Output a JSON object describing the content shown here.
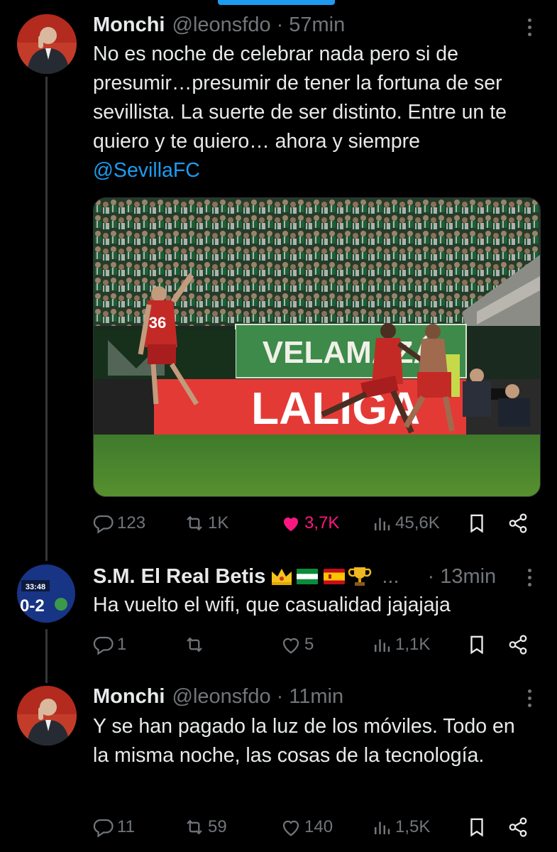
{
  "tweets": [
    {
      "name": "Monchi",
      "handle": "@leonsfdo",
      "sep": "·",
      "time": "57min",
      "text_plain": "No es noche de celebrar nada pero si de presumir…presumir de tener la fortuna de ser sevillista. La suerte de ser distinto. Entre un te quiero y te quiero… ahora y siempre ",
      "mention": "@SevillaFC",
      "image": {
        "shirt_number": "36",
        "banner_text": "VELAMAZÁ",
        "ad_board_text": "LALIGA"
      },
      "replies": "123",
      "retweets": "1K",
      "likes": "3,7K",
      "views": "45,6K"
    },
    {
      "name": "S.M. El Real Betis",
      "emoji_trailing": "...",
      "sep": "·",
      "time": "13min",
      "text": "Ha vuelto el wifi, que casualidad jajajaja",
      "avatar_clock": "33:48",
      "avatar_score": "0-2",
      "replies": "1",
      "retweets": "",
      "likes": "5",
      "views": "1,1K"
    },
    {
      "name": "Monchi",
      "handle": "@leonsfdo",
      "sep": "·",
      "time": "11min",
      "text": "Y se han pagado la luz de los móviles. Todo en la misma noche, las cosas de la tecnología.",
      "replies": "11",
      "retweets": "59",
      "likes": "140",
      "views": "1,5K"
    }
  ],
  "colors": {
    "background": "#000000",
    "text": "#e7e9ea",
    "muted": "#71767b",
    "accent": "#1d9bf0",
    "like_active": "#f91880"
  },
  "icons": [
    "reply-icon",
    "retweet-icon",
    "like-icon",
    "views-icon",
    "bookmark-icon",
    "share-icon",
    "more-icon"
  ]
}
